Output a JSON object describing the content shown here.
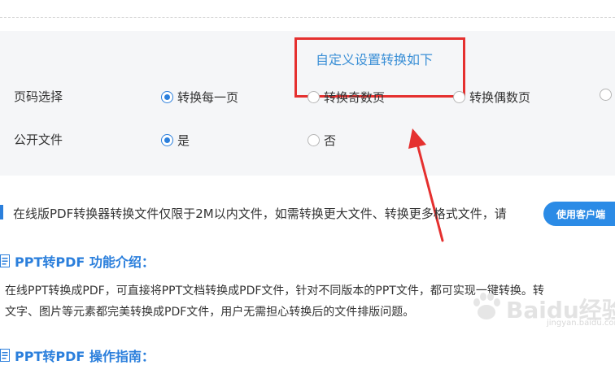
{
  "settings": {
    "callout": "自定义设置转换如下",
    "page_select": {
      "label": "页码选择",
      "options": [
        {
          "label": "转换每一页",
          "checked": true
        },
        {
          "label": "转换奇数页",
          "checked": false
        },
        {
          "label": "转换偶数页",
          "checked": false
        }
      ]
    },
    "public_file": {
      "label": "公开文件",
      "options": [
        {
          "label": "是",
          "checked": true
        },
        {
          "label": "否",
          "checked": false
        }
      ]
    }
  },
  "notice": {
    "text": "在线版PDF转换器转换文件仅限于2M以内文件，如需转换更大文件、转换更多格式文件，请",
    "button_label": "使用客户端"
  },
  "intro": {
    "title": "PPT转PDF 功能介绍：",
    "line1": "在线PPT转换成PDF，可直接将PPT文档转换成PDF文件，针对不同版本的PPT文件，都可实现一键转换。转",
    "line2": "文字、图片等元素都完美转换成PDF文件，用户无需担心转换后的文件排版问题。"
  },
  "guide": {
    "title": "PPT转PDF 操作指南："
  },
  "colors": {
    "accent": "#2b7fdc",
    "annotation_red": "#e5302f",
    "panel_bg": "#f5f6f8"
  },
  "watermark": {
    "text": "Baidu经验",
    "sub": "jingyan.baidu.com"
  }
}
